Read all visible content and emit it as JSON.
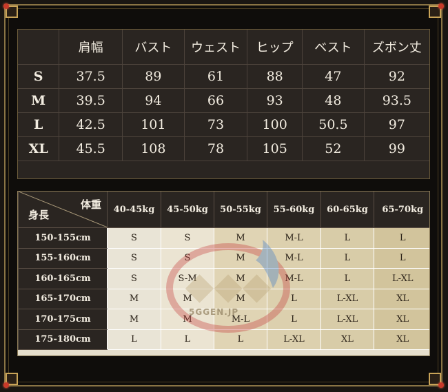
{
  "measure_table": {
    "headers": [
      "",
      "肩幅",
      "バスト",
      "ウェスト",
      "ヒップ",
      "ベスト",
      "ズボン丈"
    ],
    "rows": [
      {
        "size": "S",
        "values": [
          "37.5",
          "89",
          "61",
          "88",
          "47",
          "92"
        ]
      },
      {
        "size": "M",
        "values": [
          "39.5",
          "94",
          "66",
          "93",
          "48",
          "93.5"
        ]
      },
      {
        "size": "L",
        "values": [
          "42.5",
          "101",
          "73",
          "100",
          "50.5",
          "97"
        ]
      },
      {
        "size": "XL",
        "values": [
          "45.5",
          "108",
          "78",
          "105",
          "52",
          "99"
        ]
      }
    ]
  },
  "size_chart": {
    "corner_top": "体重",
    "corner_bottom": "身長",
    "weights": [
      "40-45kg",
      "45-50kg",
      "50-55kg",
      "55-60kg",
      "60-65kg",
      "65-70kg"
    ],
    "rows": [
      {
        "height": "150-155cm",
        "sizes": [
          "S",
          "S",
          "M",
          "M-L",
          "L",
          "L"
        ]
      },
      {
        "height": "155-160cm",
        "sizes": [
          "S",
          "S",
          "M",
          "M-L",
          "L",
          "L"
        ]
      },
      {
        "height": "160-165cm",
        "sizes": [
          "S",
          "S-M",
          "M",
          "M-L",
          "L",
          "L-XL"
        ]
      },
      {
        "height": "165-170cm",
        "sizes": [
          "M",
          "M",
          "M",
          "L",
          "L-XL",
          "XL"
        ]
      },
      {
        "height": "170-175cm",
        "sizes": [
          "M",
          "M",
          "M-L",
          "L",
          "L-XL",
          "XL"
        ]
      },
      {
        "height": "175-180cm",
        "sizes": [
          "L",
          "L",
          "L",
          "L-XL",
          "XL",
          "XL"
        ]
      }
    ]
  },
  "watermark": {
    "text": "5GGEN.JP"
  },
  "colors": {
    "frame": "#8a7444",
    "dark_panel": "#2a2521",
    "light_panel": "#e6dfcd",
    "gem": "#c83a2a"
  }
}
